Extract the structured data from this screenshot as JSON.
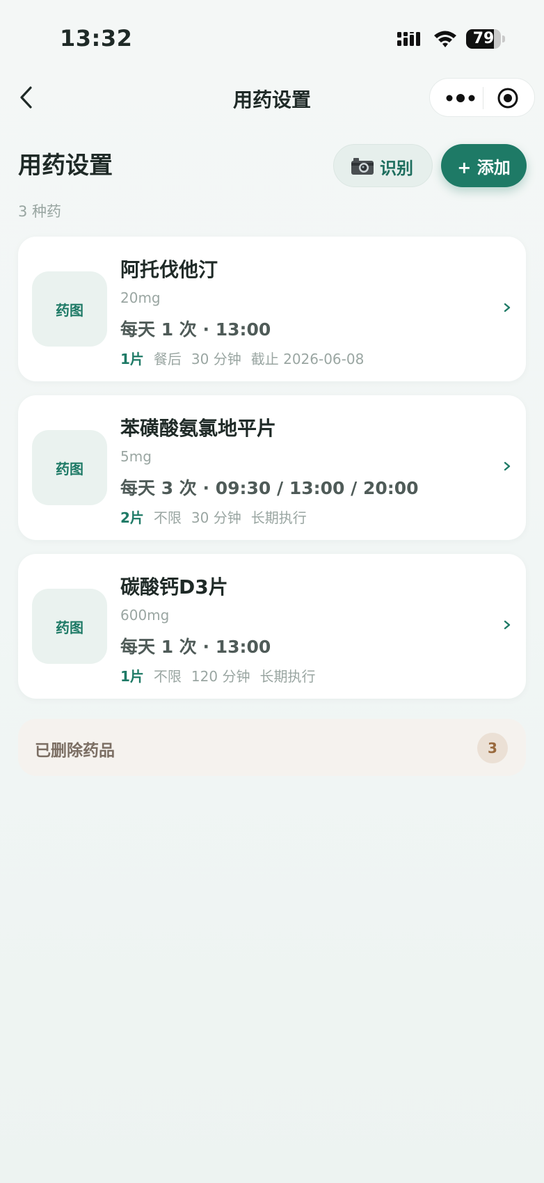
{
  "status_bar": {
    "time": "13:32",
    "battery_level": "79",
    "battery_fraction": 0.79
  },
  "nav": {
    "title": "用药设置"
  },
  "header": {
    "title": "用药设置",
    "count": "3 种药",
    "recognize_label": "识别",
    "add_label": "+ 添加"
  },
  "medications": [
    {
      "thumb": "药图",
      "name": "阿托伐他汀",
      "dose": "20mg",
      "schedule": "每天 1 次 · 13:00",
      "quantity": "1片",
      "timing": "餐后",
      "interval": "30 分钟",
      "duration": "截止 2026-06-08"
    },
    {
      "thumb": "药图",
      "name": "苯磺酸氨氯地平片",
      "dose": "5mg",
      "schedule": "每天 3 次 · 09:30 / 13:00 / 20:00",
      "quantity": "2片",
      "timing": "不限",
      "interval": "30 分钟",
      "duration": "长期执行"
    },
    {
      "thumb": "药图",
      "name": "碳酸钙D3片",
      "dose": "600mg",
      "schedule": "每天 1 次 · 13:00",
      "quantity": "1片",
      "timing": "不限",
      "interval": "120 分钟",
      "duration": "长期执行"
    }
  ],
  "deleted": {
    "label": "已删除药品",
    "count": "3"
  },
  "colors": {
    "accent": "#1e7a66",
    "background": "#f2f6f5",
    "card": "#ffffff",
    "deleted_bg": "#f5f2ee"
  }
}
